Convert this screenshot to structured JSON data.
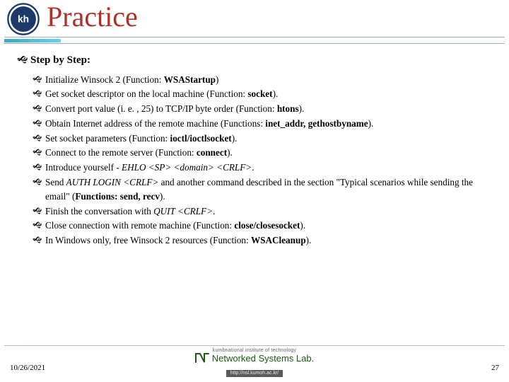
{
  "title": "Practice",
  "section_heading": "Step by Step:",
  "steps": [
    "Initialize Winsock 2 (Function: <b>WSAStartup</b>)",
    "Get socket descriptor on the local machine (Function: <b>socket</b>).",
    "Convert port value (i. e. , 25) to TCP/IP byte order (Function: <b>htons</b>).",
    "Obtain Internet address of the remote machine (Functions: <b>inet_addr, gethostbyname</b>).",
    "Set socket parameters (Function: <b>ioctl/ioctlsocket</b>).",
    "Connect to the remote server (Function: <b>connect</b>).",
    "Introduce yourself - <i>EHLO &lt;SP&gt; &lt;domain&gt; &lt;CRLF&gt;</i>.",
    "Send <i>AUTH LOGIN &lt;CRLF&gt;</i> and another command described in the section \"Typical scenarios while sending the email\" (<b>Functions: send, recv</b>).",
    "Finish the conversation with <i>QUIT &lt;CRLF&gt;</i>.",
    "Close connection with remote machine (Function: <b>close/closesocket</b>).",
    "In Windows only, free Winsock 2 resources (Function: <b>WSACleanup</b>)."
  ],
  "footer": {
    "date": "10/26/2021",
    "page": "27",
    "institute": "kumbnational institute of technology",
    "lab": "Networked Systems Lab.",
    "url": "http://nsl.kumoh.ac.kr/"
  }
}
